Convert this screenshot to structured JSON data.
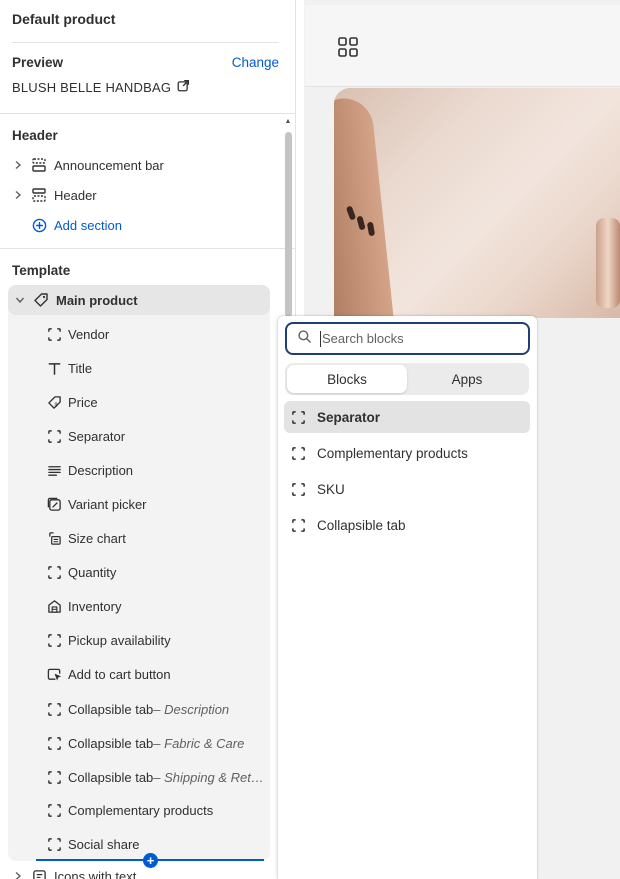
{
  "sidebar": {
    "title": "Default product",
    "preview_label": "Preview",
    "change_label": "Change",
    "product_name": "BLUSH BELLE HANDBAG",
    "header_section_title": "Header",
    "header_items": [
      {
        "label": "Announcement bar"
      },
      {
        "label": "Header"
      }
    ],
    "add_section_label": "Add section",
    "template_title": "Template",
    "main_product_label": "Main product",
    "blocks": [
      {
        "label": "Vendor",
        "suffix": "",
        "icon": "dashed-square-icon"
      },
      {
        "label": "Title",
        "suffix": "",
        "icon": "text-icon"
      },
      {
        "label": "Price",
        "suffix": "",
        "icon": "price-tag-icon"
      },
      {
        "label": "Separator",
        "suffix": "",
        "icon": "dashed-square-icon"
      },
      {
        "label": "Description",
        "suffix": "",
        "icon": "text-align-icon"
      },
      {
        "label": "Variant picker",
        "suffix": "",
        "icon": "variant-icon"
      },
      {
        "label": "Size chart",
        "suffix": "",
        "icon": "size-chart-icon"
      },
      {
        "label": "Quantity",
        "suffix": "",
        "icon": "dashed-square-icon"
      },
      {
        "label": "Inventory",
        "suffix": "",
        "icon": "inventory-icon"
      },
      {
        "label": "Pickup availability",
        "suffix": "",
        "icon": "dashed-square-icon"
      },
      {
        "label": "Add to cart button",
        "suffix": "",
        "icon": "cursor-button-icon"
      },
      {
        "label": "Collapsible tab",
        "suffix": " – Description",
        "icon": "dashed-square-icon"
      },
      {
        "label": "Collapsible tab",
        "suffix": " – Fabric & Care",
        "icon": "dashed-square-icon"
      },
      {
        "label": "Collapsible tab",
        "suffix": " – Shipping & Ret…",
        "icon": "dashed-square-icon"
      },
      {
        "label": "Complementary products",
        "suffix": "",
        "icon": "dashed-square-icon"
      },
      {
        "label": "Social share",
        "suffix": "",
        "icon": "dashed-square-icon"
      }
    ],
    "next_section_label": "Icons with text"
  },
  "popover": {
    "search_placeholder": "Search blocks",
    "tabs": [
      {
        "label": "Blocks",
        "active": true
      },
      {
        "label": "Apps",
        "active": false
      }
    ],
    "options": [
      {
        "label": "Separator",
        "selected": true
      },
      {
        "label": "Complementary products",
        "selected": false
      },
      {
        "label": "SKU",
        "selected": false
      },
      {
        "label": "Collapsible tab",
        "selected": false
      }
    ]
  },
  "colors": {
    "accent": "#005bd3",
    "text": "#303030",
    "selected_bg": "#e3e3e3",
    "search_border": "#1f3f75"
  }
}
